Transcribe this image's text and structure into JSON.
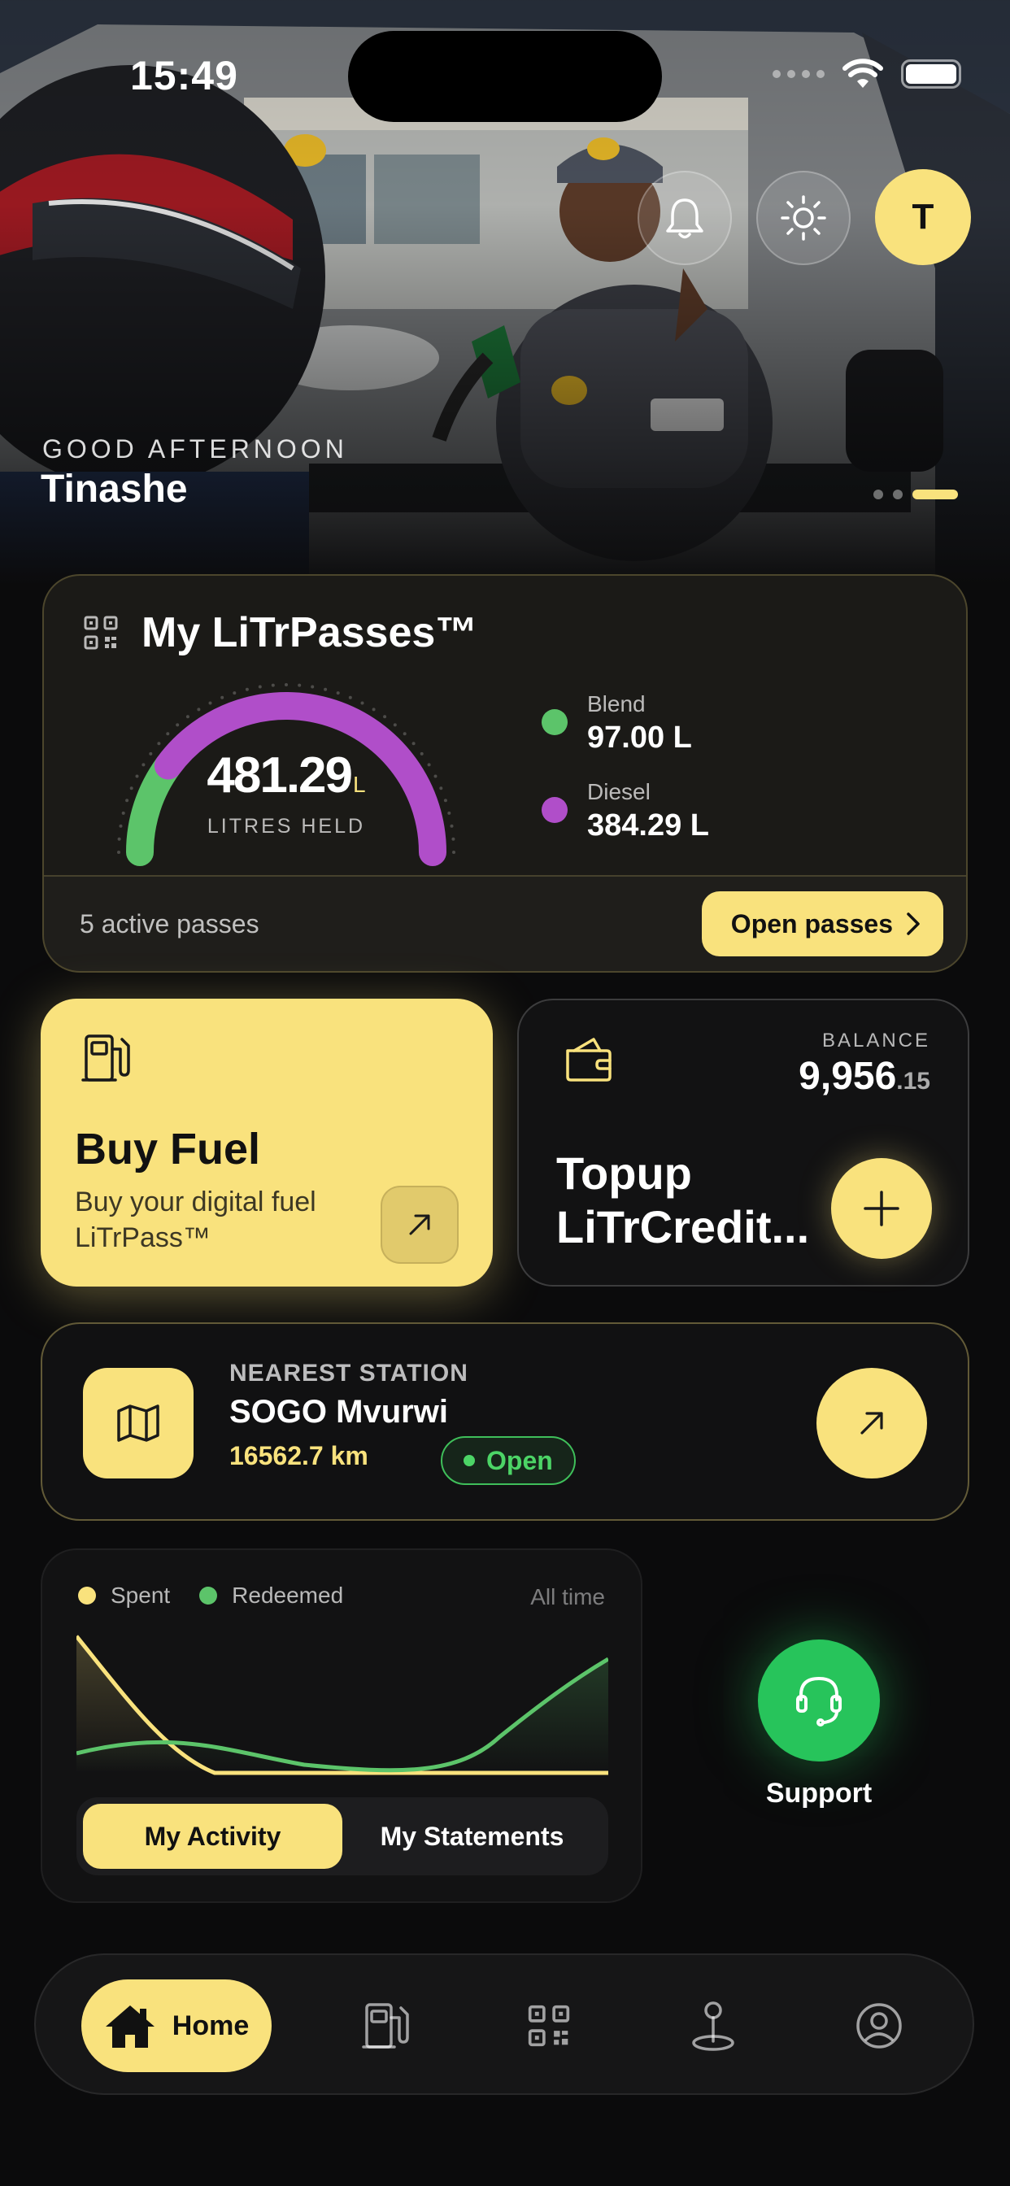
{
  "status_bar": {
    "time": "15:49"
  },
  "header": {
    "greeting": "GOOD AFTERNOON",
    "user_name": "Tinashe",
    "avatar_initial": "T"
  },
  "litrpasses": {
    "title": "My LiTrPasses™",
    "total_value": "481.29",
    "total_unit": "L",
    "total_caption": "LITRES HELD",
    "blend_label": "Blend",
    "blend_value": "97.00 L",
    "diesel_label": "Diesel",
    "diesel_value": "384.29 L",
    "active_passes": "5 active passes",
    "open_button": "Open passes"
  },
  "buy_fuel": {
    "title": "Buy Fuel",
    "subtitle": "Buy your digital fuel LiTrPass™"
  },
  "topup": {
    "balance_label": "BALANCE",
    "balance_main": "9,956",
    "balance_cents": ".15",
    "title_line1": "Topup",
    "title_line2": "LiTrCredit..."
  },
  "station": {
    "label": "NEAREST STATION",
    "name": "SOGO Mvurwi",
    "distance": "16562.7 km",
    "status": "Open"
  },
  "activity": {
    "legend_spent": "Spent",
    "legend_redeemed": "Redeemed",
    "period": "All time",
    "tab_activity": "My Activity",
    "tab_statements": "My Statements"
  },
  "support": {
    "label": "Support"
  },
  "bottom_nav": {
    "home_label": "Home"
  },
  "colors": {
    "accent_yellow": "#f9e27d",
    "blend_green": "#5cc46a",
    "diesel_purple": "#b04ec9",
    "support_green": "#27c45b",
    "open_green": "#4cd466"
  },
  "gauge_fractions": {
    "blend": 0.2015,
    "diesel": 0.7985
  }
}
